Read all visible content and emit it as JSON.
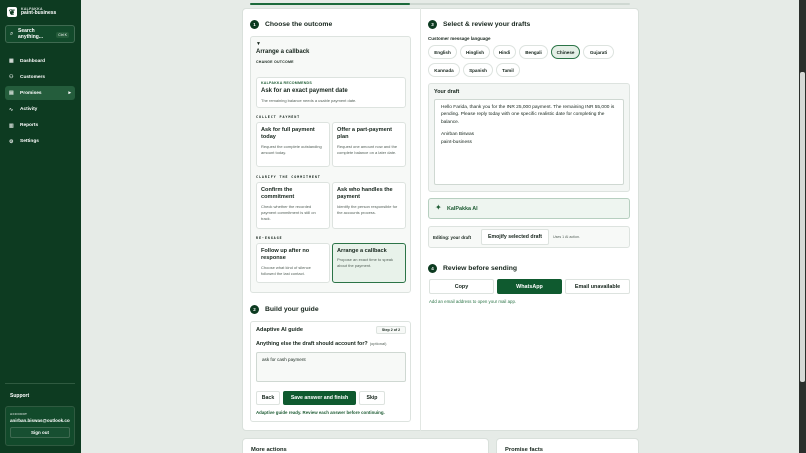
{
  "brand": {
    "small": "KALPAKKA",
    "name": "paint-business",
    "logo_icon": "leaf-logo"
  },
  "search": {
    "label": "Search anything...",
    "shortcut": "Ctrl K"
  },
  "nav": [
    {
      "label": "Dashboard",
      "icon": "grid-icon"
    },
    {
      "label": "Customers",
      "icon": "users-icon"
    },
    {
      "label": "Promises",
      "icon": "handshake-icon",
      "active": true
    },
    {
      "label": "Activity",
      "icon": "activity-icon"
    },
    {
      "label": "Reports",
      "icon": "chart-icon"
    },
    {
      "label": "Settings",
      "icon": "gear-icon"
    }
  ],
  "support_label": "Support",
  "account": {
    "label": "ACCOUNT",
    "email": "anirban.biswas@outlook.com",
    "signout": "Sign out"
  },
  "progress": 0.42,
  "step1": {
    "num": "1",
    "title": "Choose the outcome"
  },
  "outcome": {
    "caret": "▼",
    "selected_title": "Arrange a callback",
    "change_label": "CHANGE OUTCOME",
    "recommend": {
      "label": "KALPAKKA RECOMMENDS",
      "title": "Ask for an exact payment date",
      "desc": "The remaining balance needs a usable payment date."
    },
    "groups": [
      {
        "label": "COLLECT PAYMENT",
        "options": [
          {
            "title": "Ask for full payment today",
            "desc": "Request the complete outstanding amount today."
          },
          {
            "title": "Offer a part-payment plan",
            "desc": "Request one amount now and the complete balance on a later date."
          }
        ]
      },
      {
        "label": "CLARIFY THE COMMITMENT",
        "options": [
          {
            "title": "Confirm the commitment",
            "desc": "Check whether the recorded payment commitment is still on track."
          },
          {
            "title": "Ask who handles the payment",
            "desc": "Identify the person responsible for the accounts process."
          }
        ]
      },
      {
        "label": "RE-ENGAGE",
        "options": [
          {
            "title": "Follow up after no response",
            "desc": "Choose what kind of silence followed the last contact."
          },
          {
            "title": "Arrange a callback",
            "desc": "Propose an exact time to speak about the payment.",
            "selected": true
          }
        ]
      }
    ]
  },
  "step2": {
    "num": "2",
    "title": "Build your guide"
  },
  "guide": {
    "title": "Adaptive AI guide",
    "badge": "Step 2 of 2",
    "question": "Anything else the draft should account for?",
    "optional": "(optional)",
    "answer": "ask for cash payment",
    "back": "Back",
    "save": "Save answer and finish",
    "skip": "Skip",
    "status": "Adaptive guide ready. Review each answer before continuing."
  },
  "step3": {
    "num": "3",
    "title": "Select & review your drafts"
  },
  "language": {
    "label": "Customer message language",
    "options": [
      "English",
      "Hinglish",
      "Hindi",
      "Bengali",
      "Chinese",
      "Gujarati",
      "Kannada",
      "Spanish",
      "Tamil"
    ],
    "selected": "Chinese"
  },
  "draft": {
    "title": "Your draft",
    "text1": "Hello Farida, thank you for the INR 25,000 payment. The remaining INR 55,000 is pending. Please reply today with one specific realistic date for completing the balance.",
    "text2": "Anirban Biswas",
    "text3": "paint-business"
  },
  "ai": {
    "label": "KalPakka AI",
    "icon": "sparkle-icon"
  },
  "edit": {
    "label": "Editing: your draft",
    "emojify": "Emojify selected draft",
    "uses": "Uses 1 AI action."
  },
  "step4": {
    "num": "4",
    "title": "Review before sending"
  },
  "send": {
    "copy": "Copy",
    "whatsapp": "WhatsApp",
    "email": "Email unavailable",
    "note": "Add an email address to open your mail app."
  },
  "bottom": {
    "more": "More actions",
    "promise": "Promise facts"
  },
  "colors": {
    "sidebar": "#0d3b21",
    "accent": "#0f5a2f",
    "selected_bg": "#e8f2ea"
  }
}
